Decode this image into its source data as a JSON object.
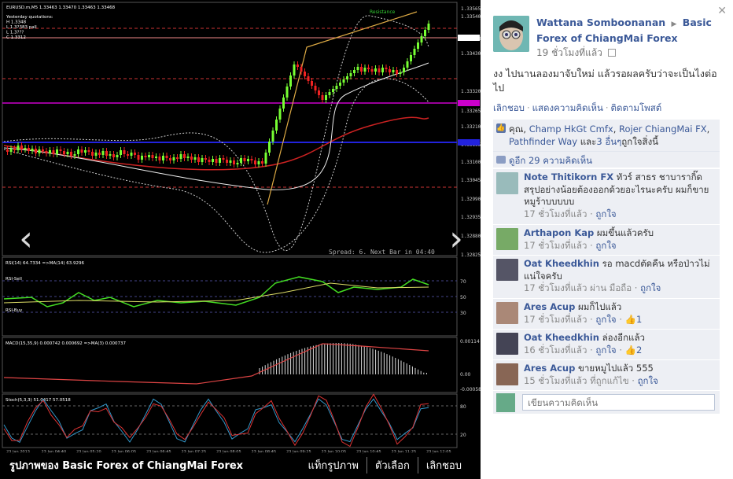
{
  "photo": {
    "caption": "รูปภาพของ Basic Forex of ChiangMai Forex",
    "actions": [
      "แท็กรูปภาพ",
      "ตัวเลือก",
      "เลิกชอบ"
    ],
    "prev_icon": "chevron-left-icon",
    "next_icon": "chevron-right-icon",
    "chart_header": "EURUSD.m,M5  1.33463 1.33470 1.33463 1.33468",
    "chart_info_lines": [
      "Yesterday quotations:",
      "H 1.3348",
      "L 1.3?383 pall",
      "L 1.3???",
      "C 1.3312"
    ],
    "resistance_label": "Resistance",
    "spread_text": "Spread: 6.   Next Bar in 04:40",
    "price_labels": [
      "1.33565",
      "1.33540",
      "1.33468",
      "1.33430",
      "1.33320",
      "1.33265",
      "1.33210",
      "1.33165",
      "1.33100",
      "1.33045",
      "1.32990",
      "1.32935",
      "1.32880",
      "1.32825"
    ],
    "rsi_header": "RSI(14) 64.7334   =>MA(14) 63.9296",
    "rsi_sell": "RSI-Sell",
    "rsi_buy": "RSI-Buy",
    "rsi_levels": [
      "70",
      "50",
      "30"
    ],
    "macd_header": "MACD(15,35,9) 0.000742 0.000692   =>MA(3) 0.000737",
    "macd_levels": [
      "0.00114",
      "0.00",
      "-0.00058"
    ],
    "stoch_header": "Stoch(5,3,3) 51.0417 57.0518",
    "stoch_levels": [
      "80",
      "20"
    ],
    "time_labels": [
      "23 Jan 2013",
      "23 Jan 04:40",
      "23 Jan 05:20",
      "23 Jan 06:05",
      "23 Jan 06:45",
      "23 Jan 07:25",
      "23 Jan 08:05",
      "23 Jan 08:45",
      "23 Jan 09:25",
      "23 Jan 10:05",
      "23 Jan 10:45",
      "23 Jan 11:25",
      "23 Jan 12:05"
    ]
  },
  "post": {
    "close_icon": "close-icon",
    "author": "Wattana Somboonanan",
    "page": "Basic Forex of ChiangMai Forex",
    "time": "19 ชั่วโมงที่แล้ว",
    "text": "งง ไปนานลองมาจับใหม่ แล้วรอผลครับว่าจะเป็นไงต่อไป",
    "actions": [
      "เลิกชอบ",
      "แสดงความคิดเห็น",
      "ติดตามโพสต์"
    ]
  },
  "likes": {
    "prefix": "คุณ, ",
    "names": [
      "Champ HkGt Cmfx",
      "Rojer ChiangMai FX",
      "Pathfinder Way"
    ],
    "suffix_others": "และ",
    "others": "3 อื่นๆ",
    "suffix": "ถูกใจสิ่งนี้"
  },
  "view_comments": "ดูอีก 29 ความคิดเห็น",
  "comments": [
    {
      "name": "Note Thitikorn FX",
      "text": "ทัวร์ สาธร ชาบารากิ๊ด สรุปอย่างน้อยต้องออกด้วยอะไรนะครับ ผมก็ขายหมูร้าบบบบบ",
      "time": "17 ชั่วโมงที่แล้ว",
      "like": "ถูกใจ",
      "via": "",
      "count": ""
    },
    {
      "name": "Arthapon Kap",
      "text": "ผมขึ้นแล้วครับ",
      "time": "17 ชั่วโมงที่แล้ว",
      "like": "ถูกใจ",
      "via": "",
      "count": ""
    },
    {
      "name": "Oat Kheedkhin",
      "text": "รอ macdตัดคืน หรือป่าวไม่แน่ใจครับ",
      "time": "17 ชั่วโมงที่แล้ว",
      "like": "ถูกใจ",
      "via": "ผ่าน มือถือ",
      "count": ""
    },
    {
      "name": "Ares Acup",
      "text": "ผมก็ไปแล้ว",
      "time": "17 ชั่วโมงที่แล้ว",
      "like": "ถูกใจ",
      "via": "",
      "count": "1"
    },
    {
      "name": "Oat Kheedkhin",
      "text": "ล่องอีกแล้ว",
      "time": "16 ชั่วโมงที่แล้ว",
      "like": "ถูกใจ",
      "via": "",
      "count": "2"
    },
    {
      "name": "Ares Acup",
      "text": "ขายหมูไปแล้ว 555",
      "time": "15 ชั่วโมงที่แล้ว",
      "like": "ถูกใจ",
      "via": "ที่ถูกแก้ไข",
      "count": ""
    }
  ],
  "comment_input": {
    "placeholder": "เขียนความคิดเห็น"
  }
}
